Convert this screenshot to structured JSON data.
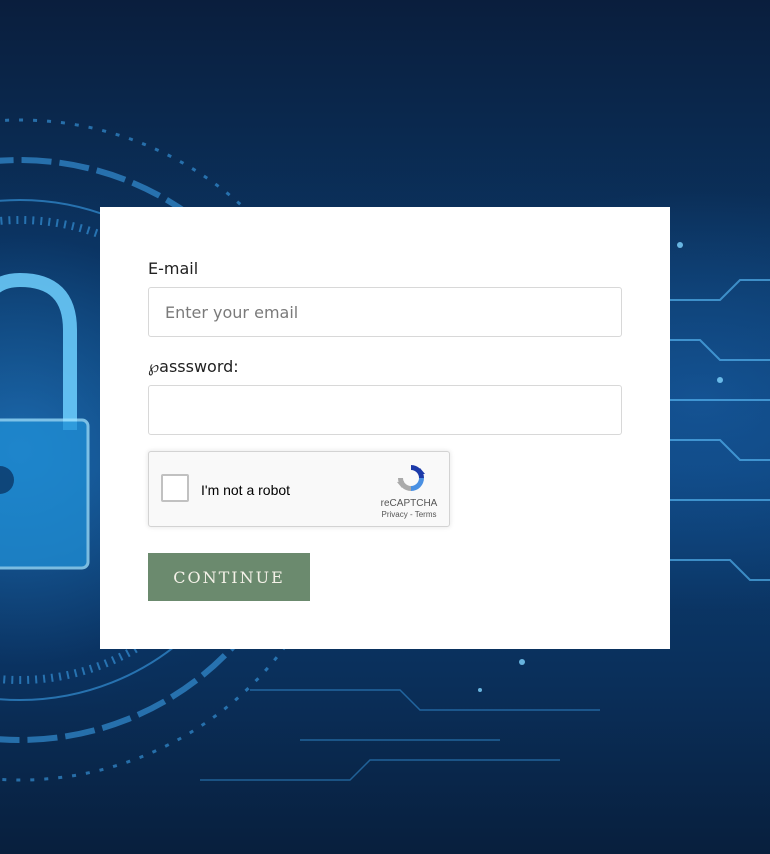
{
  "form": {
    "email_label": "E-mail",
    "email_placeholder": "Enter your email",
    "email_value": "",
    "password_label": "℘asssword:",
    "password_value": "",
    "continue_label": "CONTINUE"
  },
  "recaptcha": {
    "checkbox_label": "I'm not a robot",
    "brand": "reCAPTCHA",
    "privacy_link": "Privacy",
    "separator": " - ",
    "terms_link": "Terms",
    "checked": false
  },
  "colors": {
    "continue_button": "#6b8a6e",
    "background_dark": "#0a1e3d",
    "background_accent": "#1e78c8"
  },
  "icons": {
    "background_graphic": "padlock-circuit-illustration",
    "recaptcha_logo": "recaptcha-logo-icon"
  }
}
